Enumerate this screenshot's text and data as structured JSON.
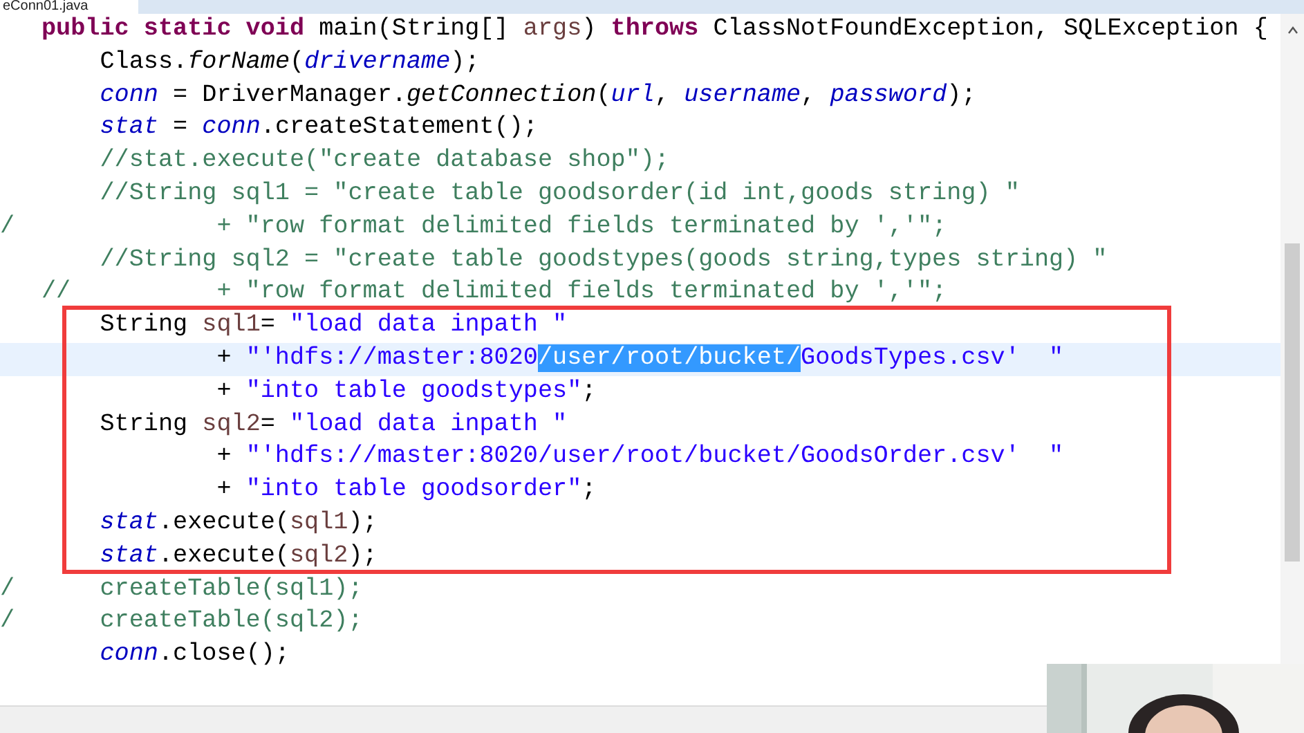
{
  "editor_tab": {
    "label": "eConn01.java"
  },
  "code_lines": [
    {
      "current": false,
      "tokens": [
        {
          "kind": "keyword",
          "text": "public static void"
        },
        {
          "kind": "plain",
          "text": " main(String[] "
        },
        {
          "kind": "local",
          "text": "args"
        },
        {
          "kind": "plain",
          "text": ") "
        },
        {
          "kind": "keyword",
          "text": "throws"
        },
        {
          "kind": "plain",
          "text": " ClassNotFoundException, SQLException {"
        }
      ]
    },
    {
      "current": false,
      "tokens": [
        {
          "kind": "plain",
          "text": "    Class."
        },
        {
          "kind": "method",
          "text": "forName"
        },
        {
          "kind": "plain",
          "text": "("
        },
        {
          "kind": "field",
          "text": "drivername"
        },
        {
          "kind": "plain",
          "text": ");"
        }
      ]
    },
    {
      "current": false,
      "tokens": [
        {
          "kind": "field",
          "text": "    conn"
        },
        {
          "kind": "plain",
          "text": " = DriverManager."
        },
        {
          "kind": "method",
          "text": "getConnection"
        },
        {
          "kind": "plain",
          "text": "("
        },
        {
          "kind": "field",
          "text": "url"
        },
        {
          "kind": "plain",
          "text": ", "
        },
        {
          "kind": "field",
          "text": "username"
        },
        {
          "kind": "plain",
          "text": ", "
        },
        {
          "kind": "field",
          "text": "password"
        },
        {
          "kind": "plain",
          "text": ");"
        }
      ]
    },
    {
      "current": false,
      "tokens": [
        {
          "kind": "field",
          "text": "    stat"
        },
        {
          "kind": "plain",
          "text": " = "
        },
        {
          "kind": "field",
          "text": "conn"
        },
        {
          "kind": "plain",
          "text": ".createStatement();"
        }
      ]
    },
    {
      "current": false,
      "tokens": [
        {
          "kind": "comment",
          "text": "    //stat.execute(\"create database shop\");"
        }
      ]
    },
    {
      "current": false,
      "tokens": [
        {
          "kind": "comment",
          "text": "    //String sql1 = \"create table goodsorder(id int,goods string) \""
        }
      ]
    },
    {
      "current": false,
      "marker": "/",
      "tokens": [
        {
          "kind": "comment",
          "text": "            + \"row format delimited fields terminated by ','\";"
        }
      ]
    },
    {
      "current": false,
      "tokens": [
        {
          "kind": "comment",
          "text": "    //String sql2 = \"create table goodstypes(goods string,types string) \""
        }
      ]
    },
    {
      "current": false,
      "tokens": [
        {
          "kind": "comment",
          "text": "//          + \"row format delimited fields terminated by ','\";"
        }
      ]
    },
    {
      "current": false,
      "tokens": [
        {
          "kind": "plain",
          "text": "    String "
        },
        {
          "kind": "local",
          "text": "sql1"
        },
        {
          "kind": "plain",
          "text": "= "
        },
        {
          "kind": "string",
          "text": "\"load data inpath \""
        }
      ]
    },
    {
      "current": true,
      "tokens": [
        {
          "kind": "plain",
          "text": "            + "
        },
        {
          "kind": "string",
          "text": "\"'hdfs://master:8020"
        },
        {
          "kind": "selected",
          "text": "/user/root/bucket/"
        },
        {
          "kind": "string",
          "text": "GoodsTypes.csv'  \""
        }
      ]
    },
    {
      "current": false,
      "tokens": [
        {
          "kind": "plain",
          "text": "            + "
        },
        {
          "kind": "string",
          "text": "\"into table goodstypes\""
        },
        {
          "kind": "plain",
          "text": ";"
        }
      ]
    },
    {
      "current": false,
      "tokens": [
        {
          "kind": "plain",
          "text": "    String "
        },
        {
          "kind": "local",
          "text": "sql2"
        },
        {
          "kind": "plain",
          "text": "= "
        },
        {
          "kind": "string",
          "text": "\"load data inpath \""
        }
      ]
    },
    {
      "current": false,
      "tokens": [
        {
          "kind": "plain",
          "text": "            + "
        },
        {
          "kind": "string",
          "text": "\"'hdfs://master:8020/user/root/bucket/GoodsOrder.csv'  \""
        }
      ]
    },
    {
      "current": false,
      "tokens": [
        {
          "kind": "plain",
          "text": "            + "
        },
        {
          "kind": "string",
          "text": "\"into table goodsorder\""
        },
        {
          "kind": "plain",
          "text": ";"
        }
      ]
    },
    {
      "current": false,
      "tokens": [
        {
          "kind": "field",
          "text": "    stat"
        },
        {
          "kind": "plain",
          "text": ".execute("
        },
        {
          "kind": "local",
          "text": "sql1"
        },
        {
          "kind": "plain",
          "text": ");"
        }
      ]
    },
    {
      "current": false,
      "tokens": [
        {
          "kind": "field",
          "text": "    stat"
        },
        {
          "kind": "plain",
          "text": ".execute("
        },
        {
          "kind": "local",
          "text": "sql2"
        },
        {
          "kind": "plain",
          "text": ");"
        }
      ]
    },
    {
      "current": false,
      "marker": "/",
      "tokens": [
        {
          "kind": "comment",
          "text": "    createTable(sql1);"
        }
      ]
    },
    {
      "current": false,
      "marker": "/",
      "tokens": [
        {
          "kind": "comment",
          "text": "    createTable(sql2);"
        }
      ]
    },
    {
      "current": false,
      "tokens": [
        {
          "kind": "field",
          "text": "    conn"
        },
        {
          "kind": "plain",
          "text": ".close();"
        }
      ]
    }
  ]
}
